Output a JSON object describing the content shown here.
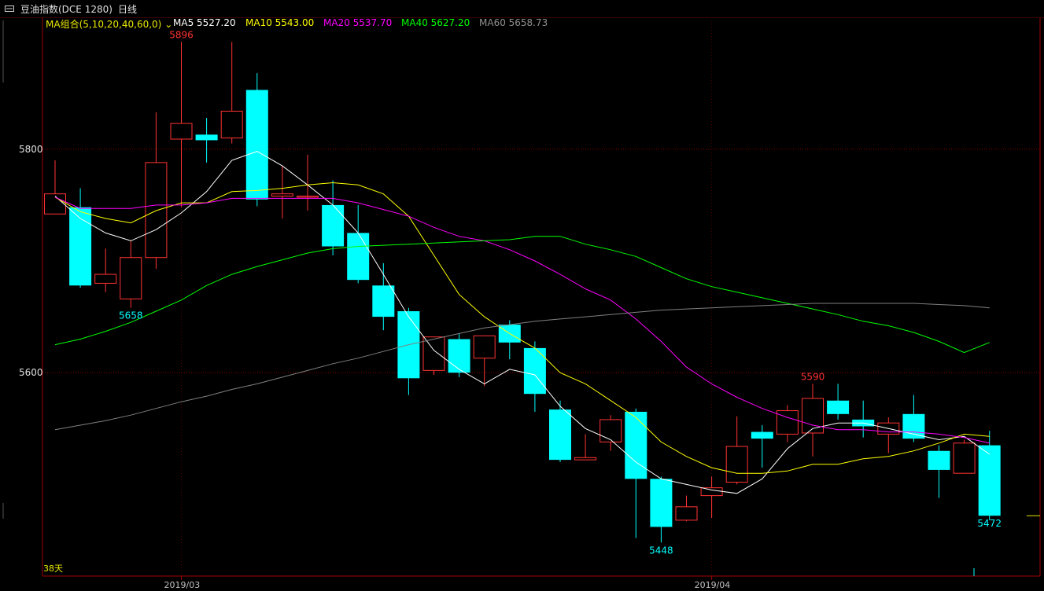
{
  "header": {
    "instrument": "豆油指数(DCE 1280)",
    "period": "日线"
  },
  "legend": {
    "group": "MA组合(5,10,20,40,60,0)",
    "items": [
      {
        "label": "MA5 5527.20",
        "color": "#ffffff"
      },
      {
        "label": "MA10 5543.00",
        "color": "#ffff00"
      },
      {
        "label": "MA20 5537.70",
        "color": "#ff00ff"
      },
      {
        "label": "MA40 5627.20",
        "color": "#00ff00"
      },
      {
        "label": "MA60 5658.73",
        "color": "#808080"
      }
    ]
  },
  "footer": {
    "days_label": "38天"
  },
  "colors": {
    "up": "#ff3333",
    "down": "#00ffff",
    "grid": "#8b0000",
    "axis": "#a00000"
  },
  "chart_data": {
    "type": "candlestick",
    "y_ticks": [
      5600,
      5800
    ],
    "ylim": [
      5418,
      5918
    ],
    "x_tick_labels": [
      {
        "label": "2019/03",
        "index": 5
      },
      {
        "label": "2019/04",
        "index": 26
      }
    ],
    "annotations": [
      {
        "text": "5896",
        "index": 5,
        "value": 5896,
        "kind": "high"
      },
      {
        "text": "5658",
        "index": 3,
        "value": 5658,
        "kind": "low"
      },
      {
        "text": "5590",
        "index": 30,
        "value": 5590,
        "kind": "high"
      },
      {
        "text": "5448",
        "index": 24,
        "value": 5448,
        "kind": "low"
      },
      {
        "text": "5472",
        "index": 37,
        "value": 5472,
        "kind": "low"
      }
    ],
    "candles": [
      {
        "o": 5742,
        "c": 5760,
        "h": 5790,
        "l": 5742
      },
      {
        "o": 5748,
        "c": 5678,
        "h": 5765,
        "l": 5676
      },
      {
        "o": 5680,
        "c": 5688,
        "h": 5711,
        "l": 5672
      },
      {
        "o": 5666,
        "c": 5703,
        "h": 5718,
        "l": 5658
      },
      {
        "o": 5703,
        "c": 5788,
        "h": 5833,
        "l": 5693
      },
      {
        "o": 5809,
        "c": 5823,
        "h": 5896,
        "l": 5748
      },
      {
        "o": 5813,
        "c": 5808,
        "h": 5828,
        "l": 5788
      },
      {
        "o": 5810,
        "c": 5834,
        "h": 5896,
        "l": 5805
      },
      {
        "o": 5853,
        "c": 5755,
        "h": 5868,
        "l": 5749
      },
      {
        "o": 5758,
        "c": 5760,
        "h": 5785,
        "l": 5738
      },
      {
        "o": 5757,
        "c": 5758,
        "h": 5795,
        "l": 5745
      },
      {
        "o": 5750,
        "c": 5713,
        "h": 5772,
        "l": 5705
      },
      {
        "o": 5725,
        "c": 5683,
        "h": 5750,
        "l": 5680
      },
      {
        "o": 5678,
        "c": 5650,
        "h": 5698,
        "l": 5638
      },
      {
        "o": 5655,
        "c": 5595,
        "h": 5658,
        "l": 5580
      },
      {
        "o": 5602,
        "c": 5632,
        "h": 5632,
        "l": 5598
      },
      {
        "o": 5630,
        "c": 5600,
        "h": 5635,
        "l": 5596
      },
      {
        "o": 5613,
        "c": 5633,
        "h": 5633,
        "l": 5588
      },
      {
        "o": 5643,
        "c": 5627,
        "h": 5647,
        "l": 5612
      },
      {
        "o": 5622,
        "c": 5581,
        "h": 5628,
        "l": 5565
      },
      {
        "o": 5567,
        "c": 5522,
        "h": 5575,
        "l": 5520
      },
      {
        "o": 5522,
        "c": 5524,
        "h": 5545,
        "l": 5522
      },
      {
        "o": 5538,
        "c": 5558,
        "h": 5562,
        "l": 5530
      },
      {
        "o": 5565,
        "c": 5505,
        "h": 5568,
        "l": 5452
      },
      {
        "o": 5505,
        "c": 5462,
        "h": 5507,
        "l": 5448
      },
      {
        "o": 5468,
        "c": 5480,
        "h": 5490,
        "l": 5467
      },
      {
        "o": 5490,
        "c": 5497,
        "h": 5507,
        "l": 5470
      },
      {
        "o": 5502,
        "c": 5534,
        "h": 5561,
        "l": 5500
      },
      {
        "o": 5547,
        "c": 5541,
        "h": 5553,
        "l": 5515
      },
      {
        "o": 5545,
        "c": 5566,
        "h": 5571,
        "l": 5538
      },
      {
        "o": 5546,
        "c": 5577,
        "h": 5590,
        "l": 5525
      },
      {
        "o": 5575,
        "c": 5563,
        "h": 5590,
        "l": 5558
      },
      {
        "o": 5558,
        "c": 5552,
        "h": 5575,
        "l": 5542
      },
      {
        "o": 5545,
        "c": 5555,
        "h": 5560,
        "l": 5528
      },
      {
        "o": 5563,
        "c": 5541,
        "h": 5580,
        "l": 5538
      },
      {
        "o": 5530,
        "c": 5513,
        "h": 5535,
        "l": 5488
      },
      {
        "o": 5510,
        "c": 5537,
        "h": 5540,
        "l": 5510
      },
      {
        "o": 5535,
        "c": 5472,
        "h": 5548,
        "l": 5468
      }
    ],
    "series": [
      {
        "name": "MA5",
        "color": "#ffffff",
        "values": [
          5758,
          5738,
          5725,
          5718,
          5728,
          5743,
          5762,
          5790,
          5798,
          5785,
          5768,
          5750,
          5725,
          5688,
          5650,
          5620,
          5603,
          5590,
          5603,
          5598,
          5570,
          5550,
          5540,
          5520,
          5505,
          5500,
          5495,
          5492,
          5505,
          5532,
          5550,
          5555,
          5555,
          5550,
          5545,
          5540,
          5543,
          5527
        ]
      },
      {
        "name": "MA10",
        "color": "#ffff00",
        "values": [
          5757,
          5744,
          5738,
          5734,
          5745,
          5752,
          5752,
          5762,
          5763,
          5765,
          5768,
          5770,
          5768,
          5760,
          5740,
          5705,
          5670,
          5650,
          5635,
          5622,
          5600,
          5590,
          5575,
          5560,
          5538,
          5525,
          5515,
          5510,
          5510,
          5512,
          5518,
          5518,
          5523,
          5525,
          5530,
          5537,
          5545,
          5543
        ]
      },
      {
        "name": "MA20",
        "color": "#ff00ff",
        "values": [
          5757,
          5747,
          5747,
          5747,
          5750,
          5750,
          5752,
          5756,
          5756,
          5756,
          5756,
          5756,
          5752,
          5746,
          5740,
          5730,
          5722,
          5718,
          5710,
          5700,
          5688,
          5675,
          5665,
          5648,
          5628,
          5605,
          5590,
          5578,
          5568,
          5560,
          5553,
          5549,
          5549,
          5547,
          5547,
          5545,
          5542,
          5537
        ]
      },
      {
        "name": "MA40",
        "color": "#00ff00",
        "values": [
          5625,
          5630,
          5637,
          5645,
          5655,
          5665,
          5678,
          5688,
          5695,
          5701,
          5707,
          5711,
          5713,
          5714,
          5715,
          5716,
          5717,
          5718,
          5719,
          5722,
          5722,
          5715,
          5710,
          5704,
          5694,
          5684,
          5677,
          5672,
          5667,
          5662,
          5657,
          5652,
          5646,
          5642,
          5636,
          5628,
          5618,
          5627
        ]
      },
      {
        "name": "MA60",
        "color": "#808080",
        "values": [
          5549,
          5553,
          5557,
          5562,
          5568,
          5574,
          5579,
          5585,
          5590,
          5596,
          5602,
          5608,
          5613,
          5619,
          5625,
          5630,
          5635,
          5640,
          5643,
          5646,
          5648,
          5650,
          5652,
          5654,
          5656,
          5657,
          5658,
          5659,
          5660,
          5661,
          5662,
          5662,
          5662,
          5662,
          5662,
          5661,
          5660,
          5658
        ]
      }
    ]
  }
}
